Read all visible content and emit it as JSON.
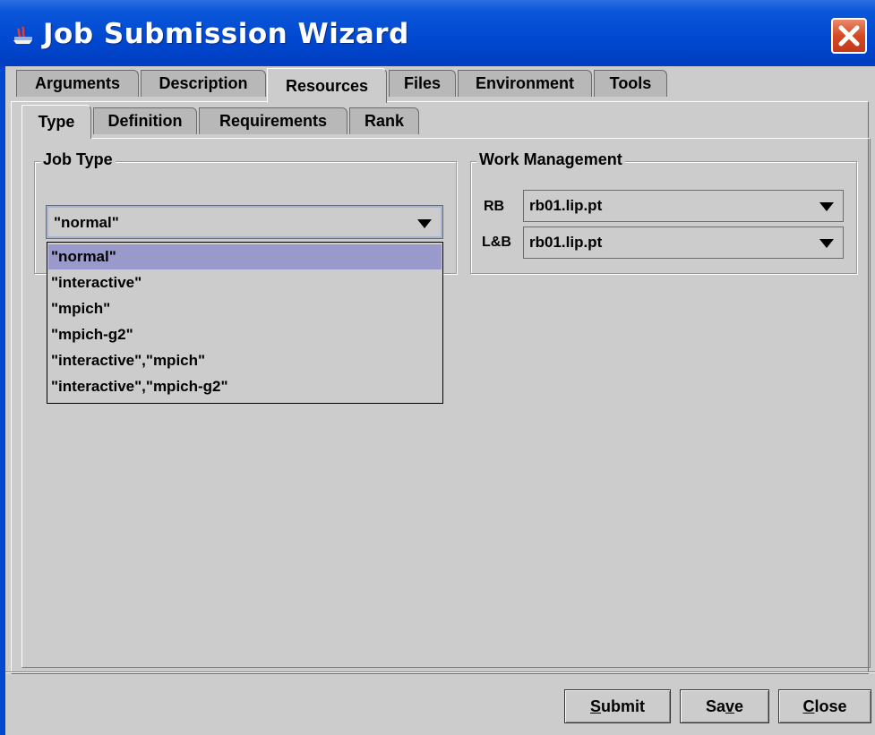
{
  "window": {
    "title": "Job Submission Wizard"
  },
  "main_tabs": [
    {
      "label": "Arguments",
      "active": false
    },
    {
      "label": "Description",
      "active": false
    },
    {
      "label": "Resources",
      "active": true
    },
    {
      "label": "Files",
      "active": false
    },
    {
      "label": "Environment",
      "active": false
    },
    {
      "label": "Tools",
      "active": false
    }
  ],
  "sub_tabs": [
    {
      "label": "Type",
      "active": true
    },
    {
      "label": "Definition",
      "active": false
    },
    {
      "label": "Requirements",
      "active": false
    },
    {
      "label": "Rank",
      "active": false
    }
  ],
  "job_type": {
    "title": "Job Type",
    "selected": "\"normal\"",
    "options": [
      "\"normal\"",
      "\"interactive\"",
      "\"mpich\"",
      "\"mpich-g2\"",
      "\"interactive\",\"mpich\"",
      "\"interactive\",\"mpich-g2\""
    ]
  },
  "work_management": {
    "title": "Work Management",
    "rb_label": "RB",
    "rb_value": "rb01.lip.pt",
    "lb_label": "L&B",
    "lb_value": "rb01.lip.pt"
  },
  "buttons": {
    "submit_pre": "",
    "submit_mn": "S",
    "submit_post": "ubmit",
    "save_pre": "Sa",
    "save_mn": "v",
    "save_post": "e",
    "close_pre": "",
    "close_mn": "C",
    "close_post": "lose"
  },
  "colors": {
    "title_bar": "#0048d0",
    "selection": "#9999cc",
    "close_button": "#d44a22"
  }
}
